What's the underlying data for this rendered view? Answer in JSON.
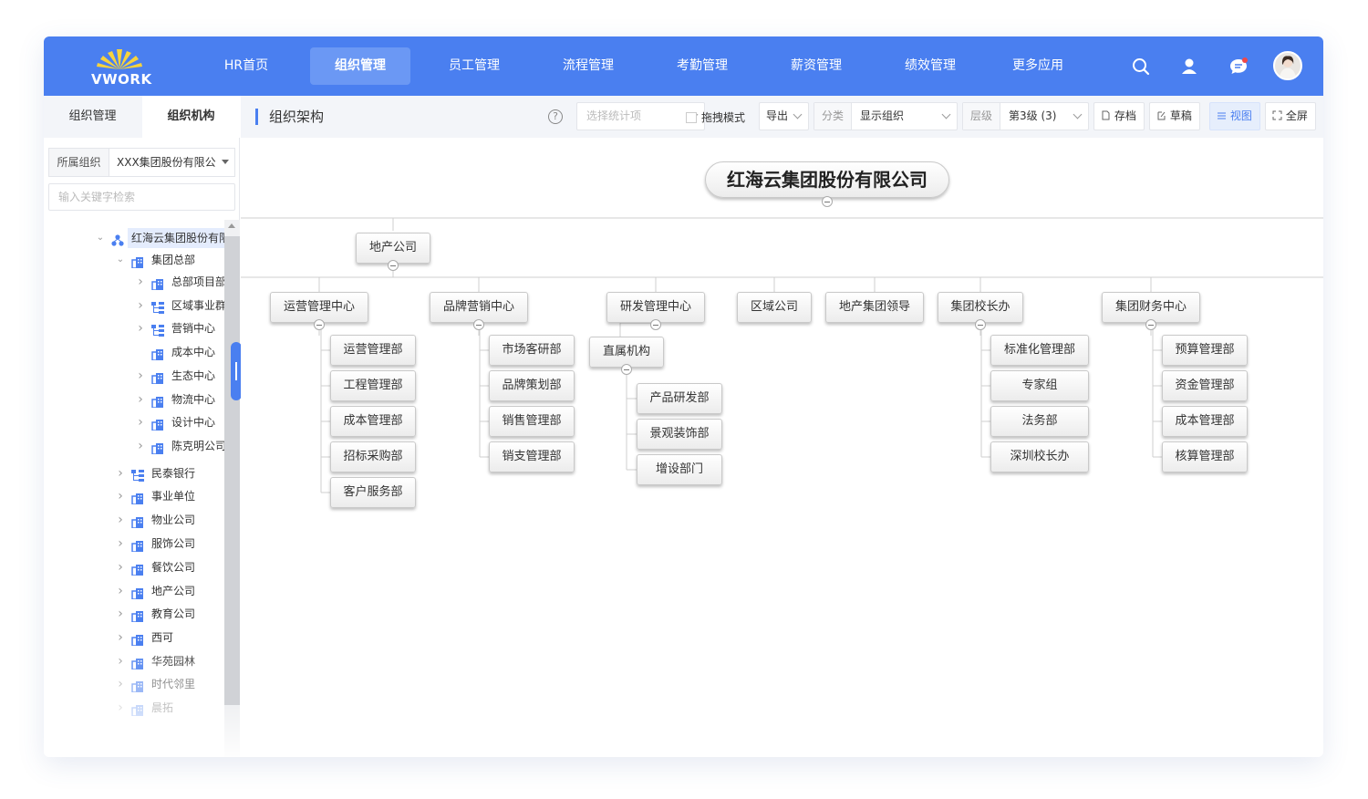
{
  "app": {
    "brand": "VWORK",
    "nav": [
      "HR首页",
      "组织管理",
      "员工管理",
      "流程管理",
      "考勤管理",
      "薪资管理",
      "绩效管理",
      "更多应用"
    ],
    "active_nav": "组织管理",
    "accent_color": "#4a7ff0",
    "icons": [
      "search-icon",
      "user-icon",
      "chat-icon",
      "avatar"
    ]
  },
  "sidebar": {
    "tabs": [
      "组织管理",
      "组织机构"
    ],
    "active_tab": "组织机构",
    "org_label": "所属组织",
    "org_value": "XXX集团股份有限公",
    "search_placeholder": "输入关键字检索",
    "tree": [
      {
        "label": "红海云集团股份有限公司",
        "icon": "org-icon",
        "expanded": true,
        "selected": true
      },
      {
        "label": "集团总部",
        "icon": "building-icon",
        "expanded": true
      },
      {
        "label": "总部项目部",
        "icon": "building-icon"
      },
      {
        "label": "区域事业群",
        "icon": "group-icon"
      },
      {
        "label": "营销中心",
        "icon": "group-icon"
      },
      {
        "label": "成本中心",
        "icon": "building-icon"
      },
      {
        "label": "生态中心",
        "icon": "building-icon"
      },
      {
        "label": "物流中心",
        "icon": "building-icon"
      },
      {
        "label": "设计中心",
        "icon": "building-icon"
      },
      {
        "label": "陈克明公司",
        "icon": "building-icon"
      },
      {
        "label": "民泰银行",
        "icon": "group-icon"
      },
      {
        "label": "事业单位",
        "icon": "building-icon"
      },
      {
        "label": "物业公司",
        "icon": "building-icon"
      },
      {
        "label": "服饰公司",
        "icon": "building-icon"
      },
      {
        "label": "餐饮公司",
        "icon": "building-icon"
      },
      {
        "label": "地产公司",
        "icon": "building-icon"
      },
      {
        "label": "教育公司",
        "icon": "building-icon"
      },
      {
        "label": "西可",
        "icon": "building-icon"
      },
      {
        "label": "华苑园林",
        "icon": "building-icon"
      },
      {
        "label": "时代邻里",
        "icon": "building-icon"
      },
      {
        "label": "晨拓",
        "icon": "building-icon"
      }
    ]
  },
  "main": {
    "title": "组织架构",
    "toolbar": {
      "stat_placeholder": "选择统计项",
      "drag_mode": "拖拽模式",
      "export": "导出",
      "category_label": "分类",
      "category_value": "显示组织",
      "level_label": "层级",
      "level_value": "第3级 (3)",
      "archive": "存档",
      "draft": "草稿",
      "view": "视图",
      "fullscreen": "全屏"
    },
    "orgchart": {
      "root": "红海云集团股份有限公司",
      "level1": "地产公司",
      "departments": [
        {
          "name": "运营管理中心",
          "children": [
            "运营管理部",
            "工程管理部",
            "成本管理部",
            "招标采购部",
            "客户服务部"
          ]
        },
        {
          "name": "品牌营销中心",
          "children": [
            "市场客研部",
            "品牌策划部",
            "销售管理部",
            "销支管理部"
          ]
        },
        {
          "name": "研发管理中心",
          "children": [
            "直属机构"
          ],
          "grandchildren": [
            "产品研发部",
            "景观装饰部",
            "增设部门"
          ]
        },
        {
          "name": "区域公司",
          "children": []
        },
        {
          "name": "地产集团领导",
          "children": []
        },
        {
          "name": "集团校长办",
          "children": [
            "标准化管理部",
            "专家组",
            "法务部",
            "深圳校长办"
          ]
        },
        {
          "name": "集团财务中心",
          "children": [
            "预算管理部",
            "资金管理部",
            "成本管理部",
            "核算管理部"
          ]
        }
      ]
    }
  }
}
